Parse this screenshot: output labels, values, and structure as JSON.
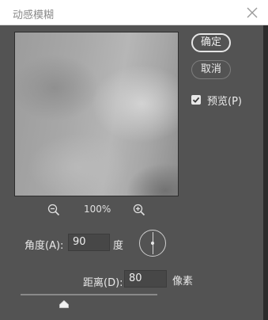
{
  "window": {
    "title": "动感模糊"
  },
  "buttons": {
    "ok_label": "确定",
    "cancel_label": "取消"
  },
  "preview_option": {
    "label": "预览(P)",
    "checked": true
  },
  "zoom": {
    "level": "100%"
  },
  "angle": {
    "label": "角度(A):",
    "value": "90",
    "unit": "度"
  },
  "distance": {
    "label": "距离(D):",
    "value": "80",
    "unit": "像素",
    "slider_fraction": 0.32
  },
  "colors": {
    "background": "#535353",
    "titlebar": "#ffffff",
    "text": "#e8e8e8"
  }
}
